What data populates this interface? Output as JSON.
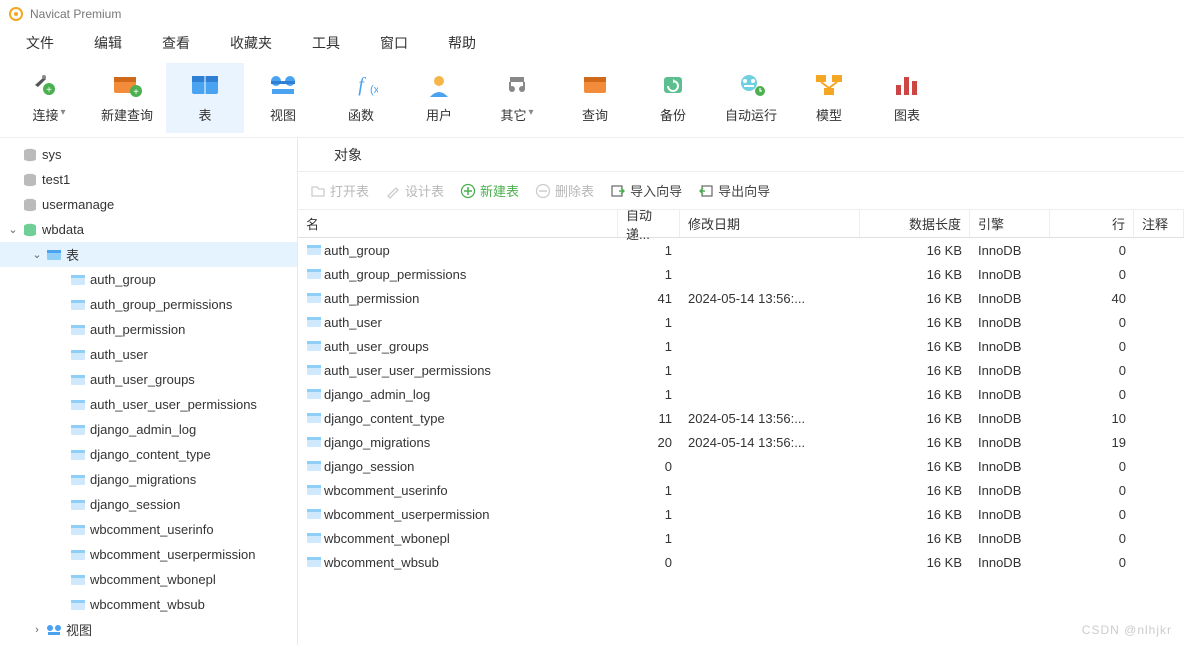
{
  "app": {
    "title": "Navicat Premium"
  },
  "menu": [
    "文件",
    "编辑",
    "查看",
    "收藏夹",
    "工具",
    "窗口",
    "帮助"
  ],
  "toolbar": [
    {
      "label": "连接",
      "icon": "plug",
      "dropdown": true
    },
    {
      "label": "新建查询",
      "icon": "newquery"
    },
    {
      "label": "表",
      "icon": "table",
      "selected": true
    },
    {
      "label": "视图",
      "icon": "view"
    },
    {
      "label": "函数",
      "icon": "fx"
    },
    {
      "label": "用户",
      "icon": "user"
    },
    {
      "label": "其它",
      "icon": "other",
      "dropdown": true
    },
    {
      "label": "查询",
      "icon": "query"
    },
    {
      "label": "备份",
      "icon": "backup"
    },
    {
      "label": "自动运行",
      "icon": "auto"
    },
    {
      "label": "模型",
      "icon": "model"
    },
    {
      "label": "图表",
      "icon": "chart"
    }
  ],
  "sidebar": {
    "databases": [
      {
        "name": "sys",
        "icon": "db-gray"
      },
      {
        "name": "test1",
        "icon": "db-gray"
      },
      {
        "name": "usermanage",
        "icon": "db-gray"
      },
      {
        "name": "wbdata",
        "icon": "db-green",
        "expanded": true,
        "selected": false,
        "children": [
          {
            "name": "表",
            "icon": "tables",
            "expanded": true,
            "selected": true,
            "children": [
              "auth_group",
              "auth_group_permissions",
              "auth_permission",
              "auth_user",
              "auth_user_groups",
              "auth_user_user_permissions",
              "django_admin_log",
              "django_content_type",
              "django_migrations",
              "django_session",
              "wbcomment_userinfo",
              "wbcomment_userpermission",
              "wbcomment_wbonepl",
              "wbcomment_wbsub"
            ]
          },
          {
            "name": "视图",
            "icon": "views",
            "expanded": false
          }
        ]
      }
    ]
  },
  "content": {
    "tab_label": "对象",
    "sub_toolbar": [
      {
        "label": "打开表",
        "disabled": true,
        "icon": "open"
      },
      {
        "label": "设计表",
        "disabled": true,
        "icon": "design"
      },
      {
        "label": "新建表",
        "green": true,
        "icon": "plus"
      },
      {
        "label": "删除表",
        "disabled": true,
        "icon": "minus"
      },
      {
        "label": "导入向导",
        "icon": "import"
      },
      {
        "label": "导出向导",
        "icon": "export"
      }
    ],
    "columns": [
      "名",
      "自动递...",
      "修改日期",
      "数据长度",
      "引擎",
      "行",
      "注释"
    ],
    "rows": [
      {
        "name": "auth_group",
        "auto": "1",
        "date": "",
        "size": "16 KB",
        "engine": "InnoDB",
        "rows": "0",
        "comment": ""
      },
      {
        "name": "auth_group_permissions",
        "auto": "1",
        "date": "",
        "size": "16 KB",
        "engine": "InnoDB",
        "rows": "0",
        "comment": ""
      },
      {
        "name": "auth_permission",
        "auto": "41",
        "date": "2024-05-14 13:56:...",
        "size": "16 KB",
        "engine": "InnoDB",
        "rows": "40",
        "comment": ""
      },
      {
        "name": "auth_user",
        "auto": "1",
        "date": "",
        "size": "16 KB",
        "engine": "InnoDB",
        "rows": "0",
        "comment": ""
      },
      {
        "name": "auth_user_groups",
        "auto": "1",
        "date": "",
        "size": "16 KB",
        "engine": "InnoDB",
        "rows": "0",
        "comment": ""
      },
      {
        "name": "auth_user_user_permissions",
        "auto": "1",
        "date": "",
        "size": "16 KB",
        "engine": "InnoDB",
        "rows": "0",
        "comment": ""
      },
      {
        "name": "django_admin_log",
        "auto": "1",
        "date": "",
        "size": "16 KB",
        "engine": "InnoDB",
        "rows": "0",
        "comment": ""
      },
      {
        "name": "django_content_type",
        "auto": "11",
        "date": "2024-05-14 13:56:...",
        "size": "16 KB",
        "engine": "InnoDB",
        "rows": "10",
        "comment": ""
      },
      {
        "name": "django_migrations",
        "auto": "20",
        "date": "2024-05-14 13:56:...",
        "size": "16 KB",
        "engine": "InnoDB",
        "rows": "19",
        "comment": ""
      },
      {
        "name": "django_session",
        "auto": "0",
        "date": "",
        "size": "16 KB",
        "engine": "InnoDB",
        "rows": "0",
        "comment": ""
      },
      {
        "name": "wbcomment_userinfo",
        "auto": "1",
        "date": "",
        "size": "16 KB",
        "engine": "InnoDB",
        "rows": "0",
        "comment": ""
      },
      {
        "name": "wbcomment_userpermission",
        "auto": "1",
        "date": "",
        "size": "16 KB",
        "engine": "InnoDB",
        "rows": "0",
        "comment": ""
      },
      {
        "name": "wbcomment_wbonepl",
        "auto": "1",
        "date": "",
        "size": "16 KB",
        "engine": "InnoDB",
        "rows": "0",
        "comment": ""
      },
      {
        "name": "wbcomment_wbsub",
        "auto": "0",
        "date": "",
        "size": "16 KB",
        "engine": "InnoDB",
        "rows": "0",
        "comment": ""
      }
    ]
  },
  "watermark": "CSDN @nlhjkr"
}
